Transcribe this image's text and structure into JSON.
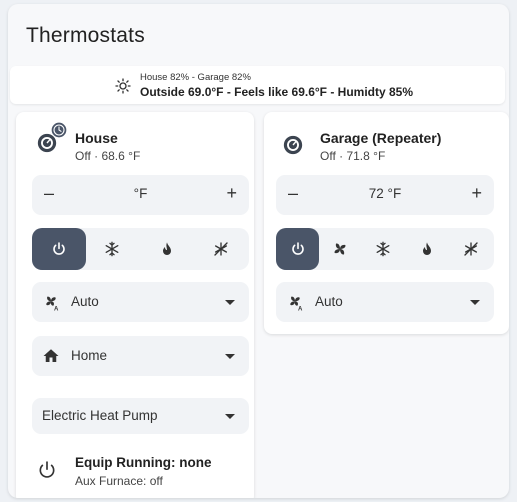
{
  "header": {
    "title": "Thermostats"
  },
  "summary": {
    "humidity_line": "House 82% - Garage 82%",
    "weather_line": "Outside 69.0°F - Feels like 69.6°F - Humidty 85%",
    "icon": "sun-icon"
  },
  "house": {
    "name": "House",
    "state": "Off · 68.6 °F",
    "target_temp": "°F",
    "minus": "–",
    "plus": "+",
    "modes": [
      "power-icon",
      "snowflake-icon",
      "flame-icon",
      "auto-off-icon"
    ],
    "active_mode": "power-icon",
    "fan_mode": "Auto",
    "preset": "Home",
    "equipment": "Electric Heat Pump",
    "equip_running": "Equip Running: none",
    "aux": "Aux Furnace: off"
  },
  "garage": {
    "name": "Garage (Repeater)",
    "state": "Off · 71.8 °F",
    "target_temp": "72 °F",
    "minus": "–",
    "plus": "+",
    "modes": [
      "power-icon",
      "fan-icon",
      "snowflake-icon",
      "flame-icon",
      "auto-off-icon"
    ],
    "active_mode": "power-icon",
    "fan_mode": "Auto"
  },
  "colors": {
    "active_mode_bg": "#4a5568",
    "control_bg": "#f1f3f6"
  }
}
